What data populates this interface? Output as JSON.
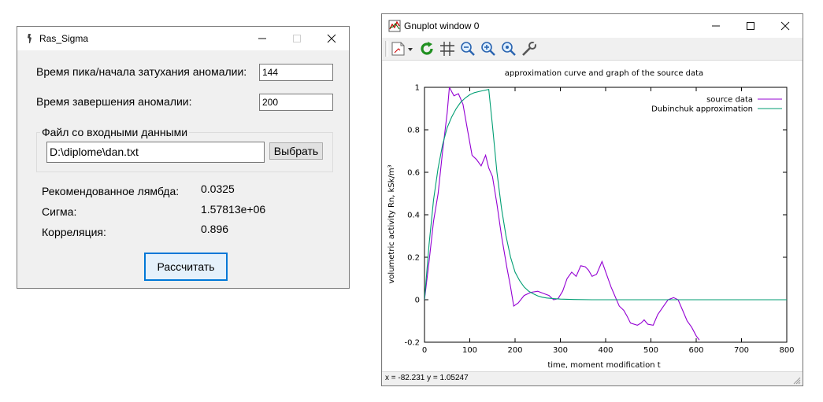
{
  "ras_window": {
    "title": "Ras_Sigma",
    "peak_label": "Время пика/начала затухания аномалии:",
    "peak_value": "144",
    "end_label": "Время завершения аномалии:",
    "end_value": "200",
    "file_group_label": "Файл со входными данными",
    "file_path": "D:\\diplome\\dan.txt",
    "browse_label": "Выбрать",
    "lambda_label": "Рекомендованное  лямбда:",
    "lambda_value": "0.0325",
    "sigma_label": "Сигма:",
    "sigma_value": "1.57813e+06",
    "corr_label": "Корреляция:",
    "corr_value": "0.896",
    "calc_label": "Рассчитать"
  },
  "gnuplot_window": {
    "title": "Gnuplot window 0",
    "status": "x = -82.231 y = 1.05247",
    "toolbar_icons": [
      "copy-options-icon",
      "refresh-icon",
      "grid-icon",
      "zoom-out-icon",
      "zoom-in-icon",
      "zoom-reset-icon",
      "settings-wrench-icon"
    ]
  },
  "chart_data": {
    "type": "line",
    "title": "approximation curve and graph of the source data",
    "xlabel": "time, moment modification t",
    "ylabel": "volumetric activity Rn, kSk/m³",
    "xlim": [
      0,
      800
    ],
    "ylim": [
      -0.2,
      1
    ],
    "xticks": [
      "0",
      "100",
      "200",
      "300",
      "400",
      "500",
      "600",
      "700",
      "800"
    ],
    "yticks": [
      "-0.2",
      "0",
      "0.2",
      "0.4",
      "0.6",
      "0.8",
      "1"
    ],
    "legend_position": "top-right",
    "series": [
      {
        "name": "source data",
        "color": "#9400d3",
        "points": [
          [
            0,
            0
          ],
          [
            10,
            0.18
          ],
          [
            20,
            0.37
          ],
          [
            30,
            0.5
          ],
          [
            40,
            0.7
          ],
          [
            50,
            0.88
          ],
          [
            55,
            1.0
          ],
          [
            65,
            0.96
          ],
          [
            75,
            0.97
          ],
          [
            85,
            0.92
          ],
          [
            95,
            0.8
          ],
          [
            105,
            0.68
          ],
          [
            115,
            0.66
          ],
          [
            125,
            0.63
          ],
          [
            135,
            0.68
          ],
          [
            142,
            0.62
          ],
          [
            150,
            0.58
          ],
          [
            160,
            0.45
          ],
          [
            170,
            0.3
          ],
          [
            182,
            0.15
          ],
          [
            190,
            0.06
          ],
          [
            197,
            -0.03
          ],
          [
            207,
            -0.015
          ],
          [
            220,
            0.02
          ],
          [
            235,
            0.035
          ],
          [
            250,
            0.04
          ],
          [
            262,
            0.03
          ],
          [
            275,
            0.02
          ],
          [
            285,
            0.0
          ],
          [
            295,
            0.005
          ],
          [
            305,
            0.04
          ],
          [
            315,
            0.1
          ],
          [
            325,
            0.13
          ],
          [
            335,
            0.11
          ],
          [
            345,
            0.16
          ],
          [
            355,
            0.155
          ],
          [
            362,
            0.14
          ],
          [
            370,
            0.11
          ],
          [
            380,
            0.12
          ],
          [
            392,
            0.18
          ],
          [
            402,
            0.12
          ],
          [
            412,
            0.06
          ],
          [
            420,
            0.02
          ],
          [
            430,
            -0.03
          ],
          [
            440,
            -0.05
          ],
          [
            448,
            -0.08
          ],
          [
            455,
            -0.11
          ],
          [
            470,
            -0.12
          ],
          [
            478,
            -0.11
          ],
          [
            485,
            -0.095
          ],
          [
            493,
            -0.115
          ],
          [
            505,
            -0.12
          ],
          [
            515,
            -0.07
          ],
          [
            528,
            -0.03
          ],
          [
            538,
            0.0
          ],
          [
            550,
            0.01
          ],
          [
            560,
            0.0
          ],
          [
            570,
            -0.05
          ],
          [
            580,
            -0.1
          ],
          [
            590,
            -0.13
          ],
          [
            600,
            -0.17
          ],
          [
            607,
            -0.19
          ]
        ]
      },
      {
        "name": "Dubinchuk approximation",
        "color": "#009e73",
        "points": [
          [
            0,
            0
          ],
          [
            10,
            0.26
          ],
          [
            20,
            0.47
          ],
          [
            30,
            0.62
          ],
          [
            40,
            0.73
          ],
          [
            50,
            0.81
          ],
          [
            60,
            0.86
          ],
          [
            70,
            0.9
          ],
          [
            80,
            0.93
          ],
          [
            90,
            0.95
          ],
          [
            100,
            0.965
          ],
          [
            110,
            0.975
          ],
          [
            120,
            0.98
          ],
          [
            130,
            0.985
          ],
          [
            142,
            0.99
          ],
          [
            150,
            0.82
          ],
          [
            160,
            0.6
          ],
          [
            170,
            0.43
          ],
          [
            180,
            0.3
          ],
          [
            190,
            0.2
          ],
          [
            200,
            0.13
          ],
          [
            210,
            0.09
          ],
          [
            220,
            0.06
          ],
          [
            230,
            0.04
          ],
          [
            240,
            0.028
          ],
          [
            250,
            0.018
          ],
          [
            260,
            0.012
          ],
          [
            270,
            0.008
          ],
          [
            285,
            0.005
          ],
          [
            300,
            0.003
          ],
          [
            330,
            0.001
          ],
          [
            370,
            0.0
          ],
          [
            500,
            0.0
          ],
          [
            700,
            0.0
          ],
          [
            800,
            0.0
          ]
        ]
      }
    ]
  }
}
